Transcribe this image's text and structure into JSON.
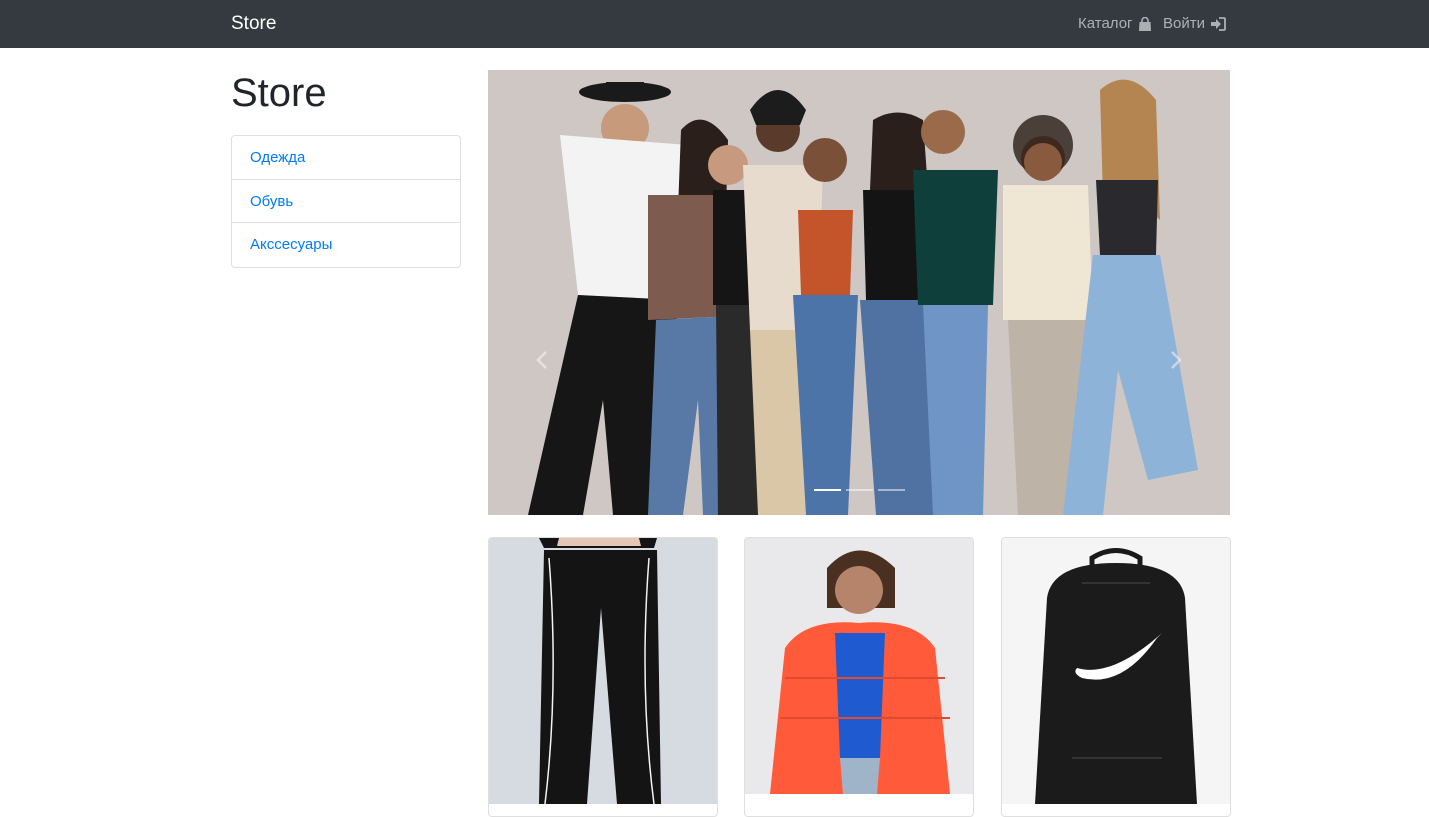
{
  "navbar": {
    "brand": "Store",
    "catalog_label": "Каталог",
    "catalog_icon": "shopping-bag-icon",
    "login_label": "Войти",
    "login_icon": "sign-in-icon"
  },
  "page": {
    "title": "Store"
  },
  "categories": [
    {
      "label": "Одежда"
    },
    {
      "label": "Обувь"
    },
    {
      "label": "Акссесуары"
    }
  ],
  "carousel": {
    "slides_count": 3,
    "active_slide": 0,
    "prev_icon": "chevron-left-icon",
    "next_icon": "chevron-right-icon"
  },
  "products": [
    {
      "image": "black-track-pants"
    },
    {
      "image": "red-nike-puffer-jacket"
    },
    {
      "image": "black-nike-backpack"
    }
  ],
  "colors": {
    "navbar_bg": "#343a40",
    "link": "#007bff",
    "page_bg": "#ffffff"
  }
}
